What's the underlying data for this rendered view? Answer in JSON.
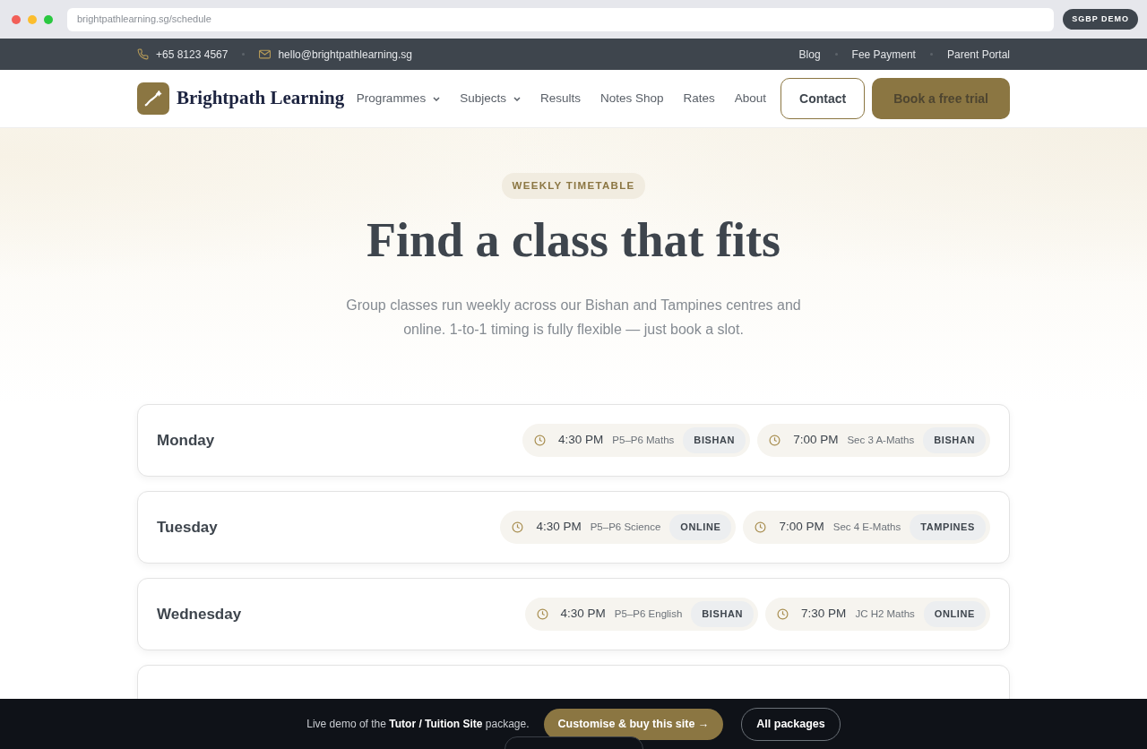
{
  "browser": {
    "url": "brightpathlearning.sg/schedule",
    "badge": "SGBP DEMO"
  },
  "topbar": {
    "phone": "+65 8123 4567",
    "email": "hello@brightpathlearning.sg",
    "links": [
      "Blog",
      "Fee Payment",
      "Parent Portal"
    ]
  },
  "navbar": {
    "brand": "Brightpath Learning",
    "items": [
      {
        "label": "Programmes",
        "dropdown": true
      },
      {
        "label": "Subjects",
        "dropdown": true
      },
      {
        "label": "Results",
        "dropdown": false
      },
      {
        "label": "Notes Shop",
        "dropdown": false
      },
      {
        "label": "Rates",
        "dropdown": false
      },
      {
        "label": "About",
        "dropdown": false
      }
    ],
    "contact": "Contact",
    "cta": "Book a free trial"
  },
  "hero": {
    "eyebrow": "WEEKLY TIMETABLE",
    "title": "Find a class that fits",
    "lead": "Group classes run weekly across our Bishan and Tampines centres and online. 1-to-1 timing is fully flexible — just book a slot."
  },
  "schedule": [
    {
      "day": "Monday",
      "classes": [
        {
          "time": "4:30 PM",
          "subject": "P5–P6 Maths",
          "location": "BISHAN"
        },
        {
          "time": "7:00 PM",
          "subject": "Sec 3 A-Maths",
          "location": "BISHAN"
        }
      ]
    },
    {
      "day": "Tuesday",
      "classes": [
        {
          "time": "4:30 PM",
          "subject": "P5–P6 Science",
          "location": "ONLINE"
        },
        {
          "time": "7:00 PM",
          "subject": "Sec 4 E-Maths",
          "location": "TAMPINES"
        }
      ]
    },
    {
      "day": "Wednesday",
      "classes": [
        {
          "time": "4:30 PM",
          "subject": "P5–P6 English",
          "location": "BISHAN"
        },
        {
          "time": "7:30 PM",
          "subject": "JC H2 Maths",
          "location": "ONLINE"
        }
      ]
    }
  ],
  "demo_bar": {
    "text": "Live demo of the **Tutor / Tuition Site** package.",
    "primary": "Customise & buy this site →",
    "secondary": "All packages"
  }
}
